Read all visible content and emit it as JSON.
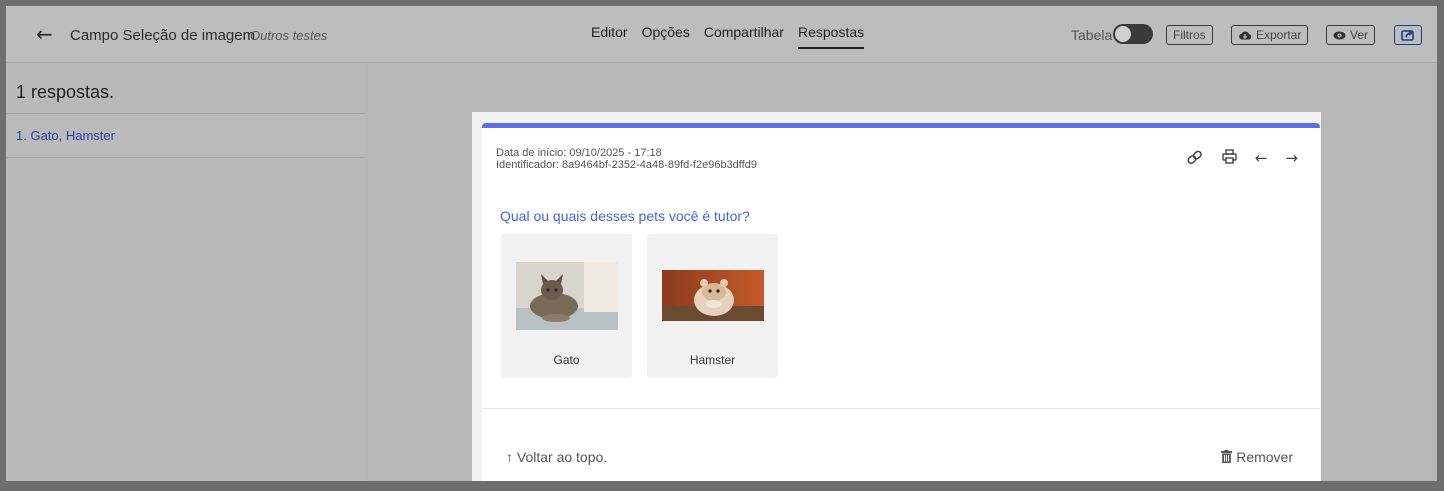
{
  "header": {
    "back_icon": "arrow-left-icon",
    "title": "Campo Seleção de imagem",
    "folder": "Outros testes",
    "tabs": [
      {
        "label": "Editor",
        "active": false
      },
      {
        "label": "Opções",
        "active": false
      },
      {
        "label": "Compartilhar",
        "active": false
      },
      {
        "label": "Respostas",
        "active": true
      }
    ],
    "table_label": "Tabela",
    "table_toggle_on": false,
    "filters_label": "Filtros",
    "export_label": "Exportar",
    "view_label": "Ver"
  },
  "sidebar": {
    "count_label": "1 respostas.",
    "items": [
      {
        "label": "1. Gato, Hamster"
      }
    ]
  },
  "response": {
    "start_date": "Data de início: 09/10/2025 - 17:18",
    "identifier": "Identificador: 8a9464bf-2352-4a48-89fd-f2e96b3dffd9",
    "question": "Qual ou quais desses pets você é tutor?",
    "options": [
      {
        "label": "Gato",
        "image": "cat-photo"
      },
      {
        "label": "Hamster",
        "image": "hamster-photo"
      }
    ],
    "back_to_top": "↑ Voltar ao topo.",
    "remove_label": "Remover"
  },
  "colors": {
    "accent": "#5a72e6",
    "link": "#2a3fa8"
  }
}
